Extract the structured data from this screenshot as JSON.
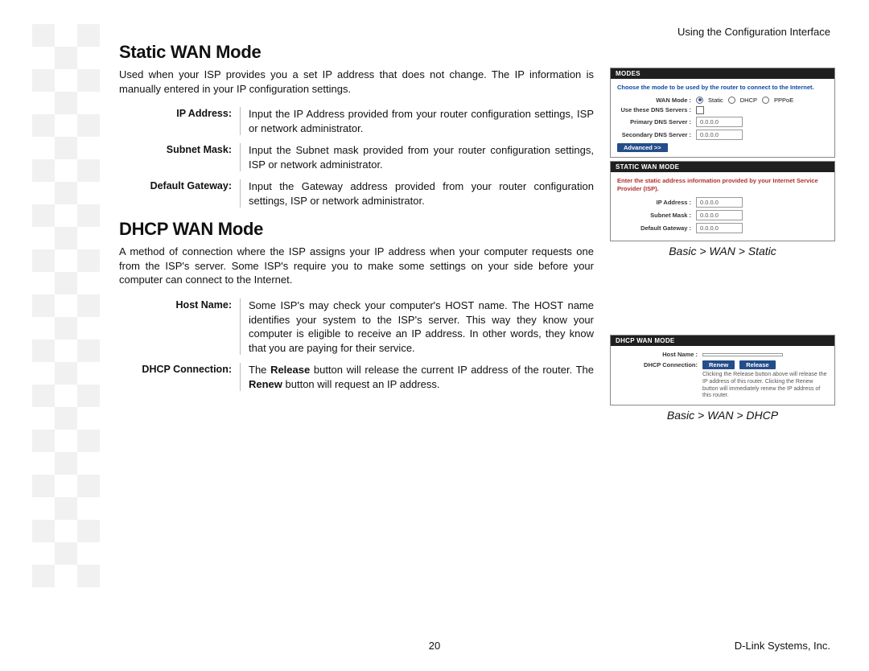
{
  "header": {
    "right": "Using the Configuration Interface"
  },
  "footer": {
    "page": "20",
    "right": "D-Link Systems, Inc."
  },
  "sections": {
    "static": {
      "heading": "Static WAN Mode",
      "intro": "Used when your ISP provides you a set IP address that does not change. The IP information is manually entered in your IP configuration settings.",
      "rows": {
        "ip_label": "IP Address:",
        "ip_text": "Input the IP Address provided from your router configuration settings, ISP or network administrator.",
        "mask_label": "Subnet Mask:",
        "mask_text": "Input the Subnet mask provided from your router configuration settings, ISP or network administrator.",
        "gw_label": "Default Gateway:",
        "gw_text": "Input the Gateway address provided from your router configuration settings, ISP or network administrator."
      }
    },
    "dhcp": {
      "heading": "DHCP WAN Mode",
      "intro": "A method of connection where the ISP assigns your IP address when your computer requests one from the ISP's server. Some ISP's require you to make some settings on your side before your computer can connect to the Internet.",
      "rows": {
        "host_label": "Host Name:",
        "host_text": "Some ISP's may check your computer's HOST name. The HOST name identifies your system to the ISP's server. This way they know your computer is eligible to receive an IP address. In other words, they know that you are paying for their service.",
        "conn_label": "DHCP Connection:",
        "conn_pre": "The ",
        "conn_b1": "Release",
        "conn_mid": " button will release the current IP address of the router. The ",
        "conn_b2": "Renew",
        "conn_post": " button will request an IP address."
      }
    }
  },
  "screenshots": {
    "modes": {
      "title": "Modes",
      "instr": "Choose the mode to be used by the router to connect to the Internet.",
      "wan_mode_label": "WAN Mode :",
      "radios": {
        "static": "Static",
        "dhcp": "DHCP",
        "pppoe": "PPPoE"
      },
      "use_dns_label": "Use these DNS Servers :",
      "pri_dns_label": "Primary DNS Server :",
      "pri_dns_val": "0.0.0.0",
      "sec_dns_label": "Secondary DNS Server :",
      "sec_dns_val": "0.0.0.0",
      "advanced_btn": "Advanced >>"
    },
    "static_panel": {
      "title": "Static WAN Mode",
      "instr": "Enter the static address information provided by your Internet Service Provider (ISP).",
      "ip_label": "IP Address :",
      "ip_val": "0.0.0.0",
      "mask_label": "Subnet Mask :",
      "mask_val": "0.0.0.0",
      "gw_label": "Default Gateway :",
      "gw_val": "0.0.0.0"
    },
    "static_caption": "Basic > WAN > Static",
    "dhcp_panel": {
      "title": "DHCP WAN Mode",
      "host_label": "Host Name :",
      "conn_label": "DHCP Connection:",
      "renew_btn": "Renew",
      "release_btn": "Release",
      "note": "Clicking the Release button above will release the IP address of this router. Clicking the Renew button will immediately renew the IP address of this router."
    },
    "dhcp_caption": "Basic > WAN > DHCP"
  }
}
